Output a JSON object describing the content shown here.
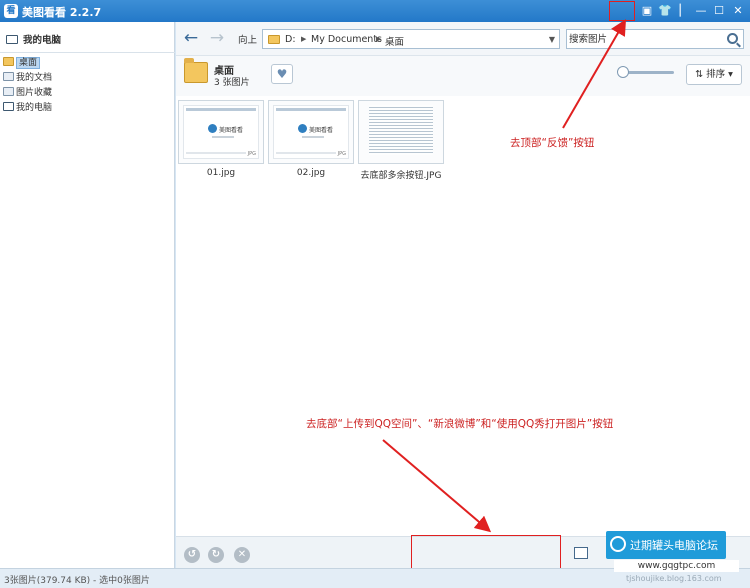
{
  "app": {
    "title": "美图看看 2.2.7",
    "icon_glyph": "看"
  },
  "title_buttons": [
    "feedback",
    "skin",
    "minimize",
    "maximize",
    "close"
  ],
  "sidebar": {
    "root": "我的电脑",
    "items": [
      {
        "label": "桌面",
        "icon": "folder-icon",
        "selected": true
      },
      {
        "label": "我的文档",
        "icon": "document-icon",
        "selected": false
      },
      {
        "label": "图片收藏",
        "icon": "document-icon",
        "selected": false
      },
      {
        "label": "我的电脑",
        "icon": "computer-icon",
        "selected": false
      }
    ]
  },
  "nav": {
    "back": "←",
    "forward": "→",
    "up_label": "向上",
    "path": [
      "D:",
      "My Documents",
      "桌面"
    ],
    "search_placeholder": "搜索图片"
  },
  "folder": {
    "name": "桌面",
    "count": "3 张图片",
    "fav_glyph": "♥"
  },
  "zoom": {
    "level": 0.1
  },
  "sort": {
    "label": "排序"
  },
  "thumbnails": [
    {
      "file": "01.jpg",
      "shot_title": "美图看看",
      "ext": "JPG"
    },
    {
      "file": "02.jpg",
      "shot_title": "美图看看",
      "ext": "JPG"
    },
    {
      "file": "去底部多余按钮.JPG",
      "shot_title": "",
      "ext": ""
    }
  ],
  "bottom_buttons": [
    "rotate-left",
    "rotate-right",
    "delete"
  ],
  "bottom_glyphs": [
    "↺",
    "↻",
    "✕"
  ],
  "status": "3张图片(379.74 KB) - 选中0张图片",
  "annotations": {
    "top": "去顶部“反馈”按钮",
    "bottom": "去底部“上传到QQ空间”、“新浪微博”和“使用QQ秀打开图片”按钮"
  },
  "watermark": {
    "text": "过期罐头电脑论坛",
    "url": "www.gqgtpc.com",
    "url2": "tjshoujike.blog.163.com"
  },
  "colors": {
    "titlebar": "#2378c8",
    "annotation": "#e02020",
    "watermark": "#1f9bd9"
  }
}
